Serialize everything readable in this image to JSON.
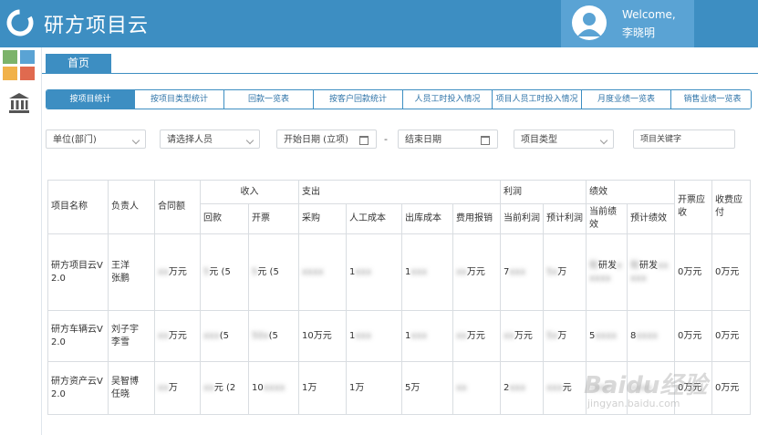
{
  "app": {
    "title": "研方项目云",
    "brand_color": "#3d8ec2"
  },
  "user": {
    "welcome": "Welcome,",
    "name": "李晓明"
  },
  "nav": {
    "home_tab": "首页"
  },
  "subtabs": [
    "按项目统计",
    "按项目类型统计",
    "回款一览表",
    "按客户回款统计",
    "人员工时投入情况",
    "项目人员工时投入情况",
    "月度业绩一览表",
    "销售业绩一览表"
  ],
  "filters": {
    "unit": "单位(部门)",
    "person": "请选择人员",
    "start_date": "开始日期 (立项)",
    "dash": "-",
    "end_date": "结束日期",
    "project_type": "项目类型",
    "keyword": "项目关键字"
  },
  "table": {
    "headers": {
      "name": "项目名称",
      "owner": "负责人",
      "contract": "合同额",
      "income": "收入",
      "income_return": "回款",
      "income_invoice": "开票",
      "expense": "支出",
      "exp_purchase": "采购",
      "exp_labor": "人工成本",
      "exp_stock": "出库成本",
      "exp_fee": "费用报销",
      "profit": "利润",
      "profit_current": "当前利润",
      "profit_expected": "预计利润",
      "perf": "绩效",
      "perf_current": "当前绩效",
      "perf_expected": "预计绩效",
      "invoice_receivable": "开票应收",
      "fee_payable": "收费应付"
    },
    "rows": [
      {
        "name": "研方项目云V2.0",
        "owner": "王洋\n张鹏",
        "contract": "万元",
        "ret": "元 (5",
        "inv": "元 (5",
        "purchase": "",
        "labor": "1",
        "stock": "1",
        "fee": "万元",
        "pc": "7",
        "pe": "万",
        "perc": "研发",
        "pere": "研发",
        "recv": "0万元",
        "pay": "0万元"
      },
      {
        "name": "研方车辆云V2.0",
        "owner": "刘子宇\n李雪",
        "contract": "万元",
        "ret": "(5",
        "inv": "(5",
        "purchase": "10万元",
        "labor": "1",
        "stock": "1",
        "fee": "万元",
        "pc": "万元",
        "pe": "万",
        "perc": "5",
        "pere": "8",
        "recv": "0万元",
        "pay": "0万元"
      },
      {
        "name": "研方资产云V2.0",
        "owner": "吴智博\n任晓",
        "contract": "万",
        "ret": "元 (2",
        "inv": "10",
        "purchase": "1万",
        "labor": "1万",
        "stock": "5万",
        "fee": "",
        "pc": "2",
        "pe": "元",
        "perc": "",
        "pere": "",
        "recv": "0万元",
        "pay": "0万元"
      }
    ]
  },
  "watermark": {
    "brand": "Baidu经验",
    "url": "jingyan.baidu.com"
  }
}
